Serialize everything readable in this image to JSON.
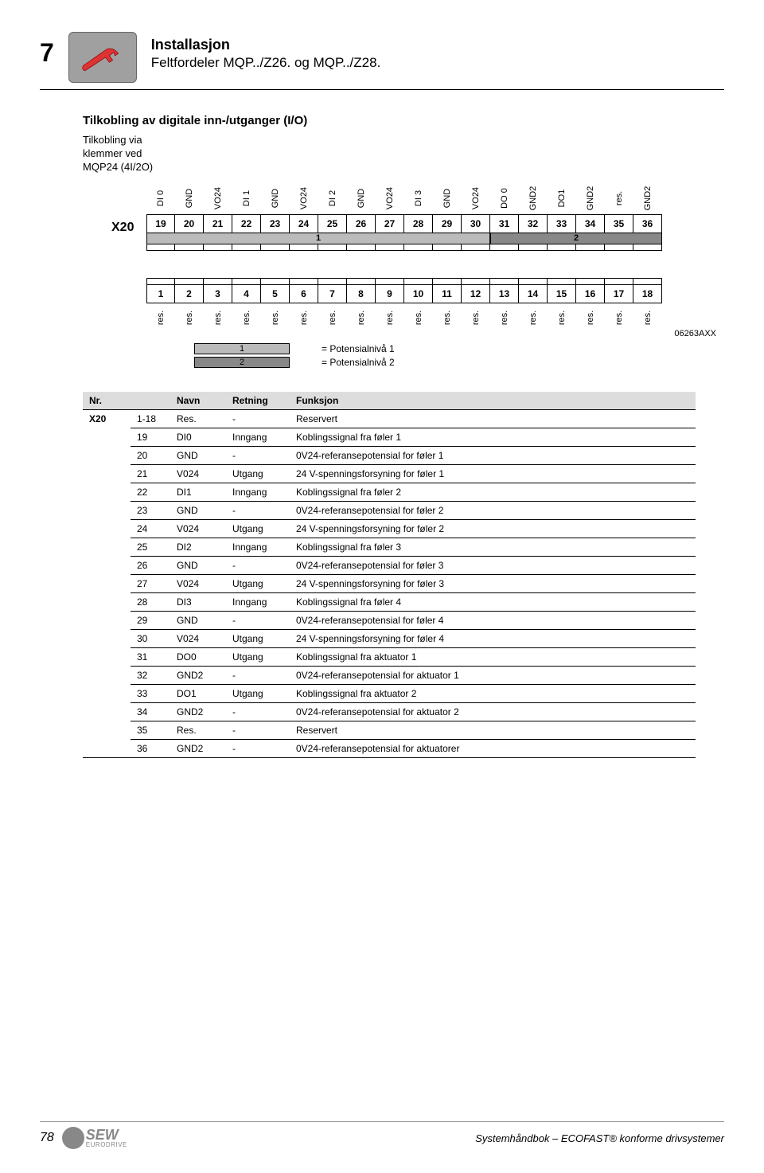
{
  "page_number": "7",
  "header": {
    "title": "Installasjon",
    "subtitle": "Feltfordeler MQP../Z26. og MQP../Z28."
  },
  "section": {
    "title": "Tilkobling av digitale inn-/utganger (I/O)",
    "subtitle_l1": "Tilkobling via",
    "subtitle_l2": "klemmer ved",
    "subtitle_l3": "MQP24 (4I/2O)"
  },
  "diagram": {
    "x20_label": "X20",
    "top_labels": [
      "DI 0",
      "GND",
      "VO24",
      "DI 1",
      "GND",
      "VO24",
      "DI 2",
      "GND",
      "VO24",
      "DI 3",
      "GND",
      "VO24",
      "DO 0",
      "GND2",
      "DO1",
      "GND2",
      "res.",
      "GND2"
    ],
    "top_nums": [
      "19",
      "20",
      "21",
      "22",
      "23",
      "24",
      "25",
      "26",
      "27",
      "28",
      "29",
      "30",
      "31",
      "32",
      "33",
      "34",
      "35",
      "36"
    ],
    "bar_top": [
      {
        "label": "1",
        "span": 12,
        "cls": "bar-gray"
      },
      {
        "label": "2",
        "span": 6,
        "cls": "bar-dark"
      }
    ],
    "bot_nums": [
      "1",
      "2",
      "3",
      "4",
      "5",
      "6",
      "7",
      "8",
      "9",
      "10",
      "11",
      "12",
      "13",
      "14",
      "15",
      "16",
      "17",
      "18"
    ],
    "bot_labels": [
      "res.",
      "res.",
      "res.",
      "res.",
      "res.",
      "res.",
      "res.",
      "res.",
      "res.",
      "res.",
      "res.",
      "res.",
      "res.",
      "res.",
      "res.",
      "res.",
      "res.",
      "res."
    ],
    "ref": "06263AXX"
  },
  "legend": {
    "l1_num": "1",
    "l1_text": "= Potensialnivå 1",
    "l2_num": "2",
    "l2_text": "= Potensialnivå 2"
  },
  "table": {
    "headers": {
      "nr": "Nr.",
      "navn": "Navn",
      "retning": "Retning",
      "funksjon": "Funksjon"
    },
    "group": "X20",
    "rows": [
      {
        "n": "1-18",
        "navn": "Res.",
        "ret": "-",
        "funk": "Reservert"
      },
      {
        "n": "19",
        "navn": "DI0",
        "ret": "Inngang",
        "funk": "Koblingssignal fra føler 1"
      },
      {
        "n": "20",
        "navn": "GND",
        "ret": "-",
        "funk": "0V24-referansepotensial for føler 1"
      },
      {
        "n": "21",
        "navn": "V024",
        "ret": "Utgang",
        "funk": "24 V-spenningsforsyning for føler 1"
      },
      {
        "n": "22",
        "navn": "DI1",
        "ret": "Inngang",
        "funk": "Koblingssignal fra føler 2"
      },
      {
        "n": "23",
        "navn": "GND",
        "ret": "-",
        "funk": "0V24-referansepotensial for føler 2"
      },
      {
        "n": "24",
        "navn": "V024",
        "ret": "Utgang",
        "funk": "24 V-spenningsforsyning for føler 2"
      },
      {
        "n": "25",
        "navn": "DI2",
        "ret": "Inngang",
        "funk": "Koblingssignal fra føler 3"
      },
      {
        "n": "26",
        "navn": "GND",
        "ret": "-",
        "funk": "0V24-referansepotensial for føler 3"
      },
      {
        "n": "27",
        "navn": "V024",
        "ret": "Utgang",
        "funk": "24 V-spenningsforsyning for føler 3"
      },
      {
        "n": "28",
        "navn": "DI3",
        "ret": "Inngang",
        "funk": "Koblingssignal fra føler 4"
      },
      {
        "n": "29",
        "navn": "GND",
        "ret": "-",
        "funk": "0V24-referansepotensial for føler 4"
      },
      {
        "n": "30",
        "navn": "V024",
        "ret": "Utgang",
        "funk": "24 V-spenningsforsyning for føler 4"
      },
      {
        "n": "31",
        "navn": "DO0",
        "ret": "Utgang",
        "funk": "Koblingssignal fra aktuator 1"
      },
      {
        "n": "32",
        "navn": "GND2",
        "ret": "-",
        "funk": "0V24-referansepotensial for aktuator 1"
      },
      {
        "n": "33",
        "navn": "DO1",
        "ret": "Utgang",
        "funk": "Koblingssignal fra aktuator 2"
      },
      {
        "n": "34",
        "navn": "GND2",
        "ret": "-",
        "funk": "0V24-referansepotensial for aktuator 2"
      },
      {
        "n": "35",
        "navn": "Res.",
        "ret": "-",
        "funk": "Reservert"
      },
      {
        "n": "36",
        "navn": "GND2",
        "ret": "-",
        "funk": "0V24-referansepotensial for aktuatorer"
      }
    ]
  },
  "footer": {
    "page": "78",
    "logo_l1": "SEW",
    "logo_l2": "EURODRIVE",
    "text": "Systemhåndbok – ECOFAST® konforme drivsystemer"
  }
}
